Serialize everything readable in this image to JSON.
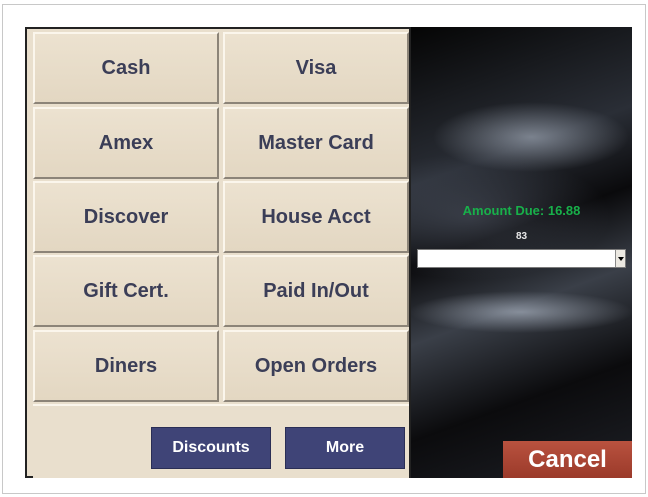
{
  "tender_buttons": [
    {
      "label": "Cash"
    },
    {
      "label": "Visa"
    },
    {
      "label": "Amex"
    },
    {
      "label": "Master Card"
    },
    {
      "label": "Discover"
    },
    {
      "label": "House Acct"
    },
    {
      "label": "Gift Cert."
    },
    {
      "label": "Paid In/Out"
    },
    {
      "label": "Diners"
    },
    {
      "label": "Open Orders"
    }
  ],
  "actions": {
    "discounts_label": "Discounts",
    "more_label": "More",
    "cancel_label": "Cancel"
  },
  "summary": {
    "amount_due": "Amount Due: 16.88",
    "small_value": "83"
  },
  "dropdown": {
    "selected_value": ""
  },
  "colors": {
    "tile_bg": "#e9dfcd",
    "tile_text": "#3b3e57",
    "navy_button": "#3f4477",
    "cancel_button": "#a94432",
    "amount_green": "#18b04a"
  },
  "icons": {
    "dropdown_arrow": "chevron-down-icon"
  }
}
